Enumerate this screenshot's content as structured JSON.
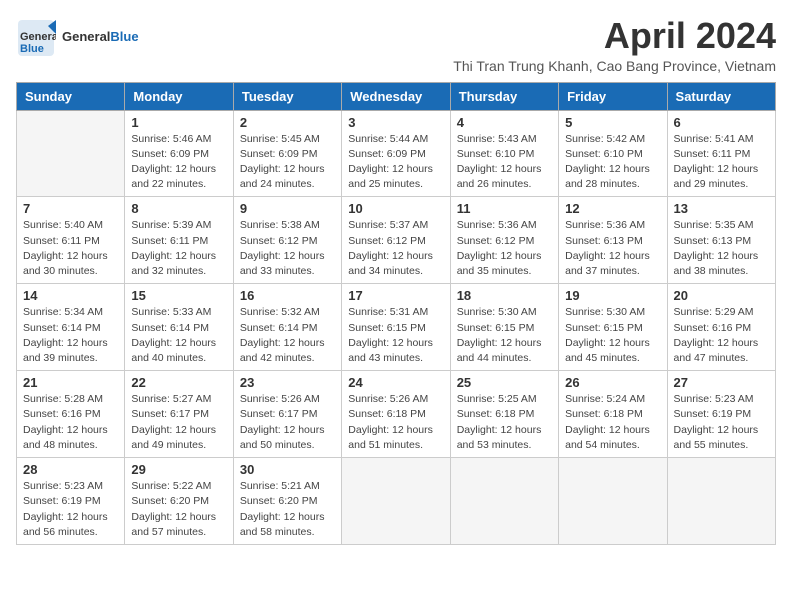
{
  "logo": {
    "general": "General",
    "blue": "Blue"
  },
  "title": "April 2024",
  "subtitle": "Thi Tran Trung Khanh, Cao Bang Province, Vietnam",
  "days_of_week": [
    "Sunday",
    "Monday",
    "Tuesday",
    "Wednesday",
    "Thursday",
    "Friday",
    "Saturday"
  ],
  "weeks": [
    [
      {
        "day": "",
        "info": ""
      },
      {
        "day": "1",
        "info": "Sunrise: 5:46 AM\nSunset: 6:09 PM\nDaylight: 12 hours\nand 22 minutes."
      },
      {
        "day": "2",
        "info": "Sunrise: 5:45 AM\nSunset: 6:09 PM\nDaylight: 12 hours\nand 24 minutes."
      },
      {
        "day": "3",
        "info": "Sunrise: 5:44 AM\nSunset: 6:09 PM\nDaylight: 12 hours\nand 25 minutes."
      },
      {
        "day": "4",
        "info": "Sunrise: 5:43 AM\nSunset: 6:10 PM\nDaylight: 12 hours\nand 26 minutes."
      },
      {
        "day": "5",
        "info": "Sunrise: 5:42 AM\nSunset: 6:10 PM\nDaylight: 12 hours\nand 28 minutes."
      },
      {
        "day": "6",
        "info": "Sunrise: 5:41 AM\nSunset: 6:11 PM\nDaylight: 12 hours\nand 29 minutes."
      }
    ],
    [
      {
        "day": "7",
        "info": "Sunrise: 5:40 AM\nSunset: 6:11 PM\nDaylight: 12 hours\nand 30 minutes."
      },
      {
        "day": "8",
        "info": "Sunrise: 5:39 AM\nSunset: 6:11 PM\nDaylight: 12 hours\nand 32 minutes."
      },
      {
        "day": "9",
        "info": "Sunrise: 5:38 AM\nSunset: 6:12 PM\nDaylight: 12 hours\nand 33 minutes."
      },
      {
        "day": "10",
        "info": "Sunrise: 5:37 AM\nSunset: 6:12 PM\nDaylight: 12 hours\nand 34 minutes."
      },
      {
        "day": "11",
        "info": "Sunrise: 5:36 AM\nSunset: 6:12 PM\nDaylight: 12 hours\nand 35 minutes."
      },
      {
        "day": "12",
        "info": "Sunrise: 5:36 AM\nSunset: 6:13 PM\nDaylight: 12 hours\nand 37 minutes."
      },
      {
        "day": "13",
        "info": "Sunrise: 5:35 AM\nSunset: 6:13 PM\nDaylight: 12 hours\nand 38 minutes."
      }
    ],
    [
      {
        "day": "14",
        "info": "Sunrise: 5:34 AM\nSunset: 6:14 PM\nDaylight: 12 hours\nand 39 minutes."
      },
      {
        "day": "15",
        "info": "Sunrise: 5:33 AM\nSunset: 6:14 PM\nDaylight: 12 hours\nand 40 minutes."
      },
      {
        "day": "16",
        "info": "Sunrise: 5:32 AM\nSunset: 6:14 PM\nDaylight: 12 hours\nand 42 minutes."
      },
      {
        "day": "17",
        "info": "Sunrise: 5:31 AM\nSunset: 6:15 PM\nDaylight: 12 hours\nand 43 minutes."
      },
      {
        "day": "18",
        "info": "Sunrise: 5:30 AM\nSunset: 6:15 PM\nDaylight: 12 hours\nand 44 minutes."
      },
      {
        "day": "19",
        "info": "Sunrise: 5:30 AM\nSunset: 6:15 PM\nDaylight: 12 hours\nand 45 minutes."
      },
      {
        "day": "20",
        "info": "Sunrise: 5:29 AM\nSunset: 6:16 PM\nDaylight: 12 hours\nand 47 minutes."
      }
    ],
    [
      {
        "day": "21",
        "info": "Sunrise: 5:28 AM\nSunset: 6:16 PM\nDaylight: 12 hours\nand 48 minutes."
      },
      {
        "day": "22",
        "info": "Sunrise: 5:27 AM\nSunset: 6:17 PM\nDaylight: 12 hours\nand 49 minutes."
      },
      {
        "day": "23",
        "info": "Sunrise: 5:26 AM\nSunset: 6:17 PM\nDaylight: 12 hours\nand 50 minutes."
      },
      {
        "day": "24",
        "info": "Sunrise: 5:26 AM\nSunset: 6:18 PM\nDaylight: 12 hours\nand 51 minutes."
      },
      {
        "day": "25",
        "info": "Sunrise: 5:25 AM\nSunset: 6:18 PM\nDaylight: 12 hours\nand 53 minutes."
      },
      {
        "day": "26",
        "info": "Sunrise: 5:24 AM\nSunset: 6:18 PM\nDaylight: 12 hours\nand 54 minutes."
      },
      {
        "day": "27",
        "info": "Sunrise: 5:23 AM\nSunset: 6:19 PM\nDaylight: 12 hours\nand 55 minutes."
      }
    ],
    [
      {
        "day": "28",
        "info": "Sunrise: 5:23 AM\nSunset: 6:19 PM\nDaylight: 12 hours\nand 56 minutes."
      },
      {
        "day": "29",
        "info": "Sunrise: 5:22 AM\nSunset: 6:20 PM\nDaylight: 12 hours\nand 57 minutes."
      },
      {
        "day": "30",
        "info": "Sunrise: 5:21 AM\nSunset: 6:20 PM\nDaylight: 12 hours\nand 58 minutes."
      },
      {
        "day": "",
        "info": ""
      },
      {
        "day": "",
        "info": ""
      },
      {
        "day": "",
        "info": ""
      },
      {
        "day": "",
        "info": ""
      }
    ]
  ]
}
